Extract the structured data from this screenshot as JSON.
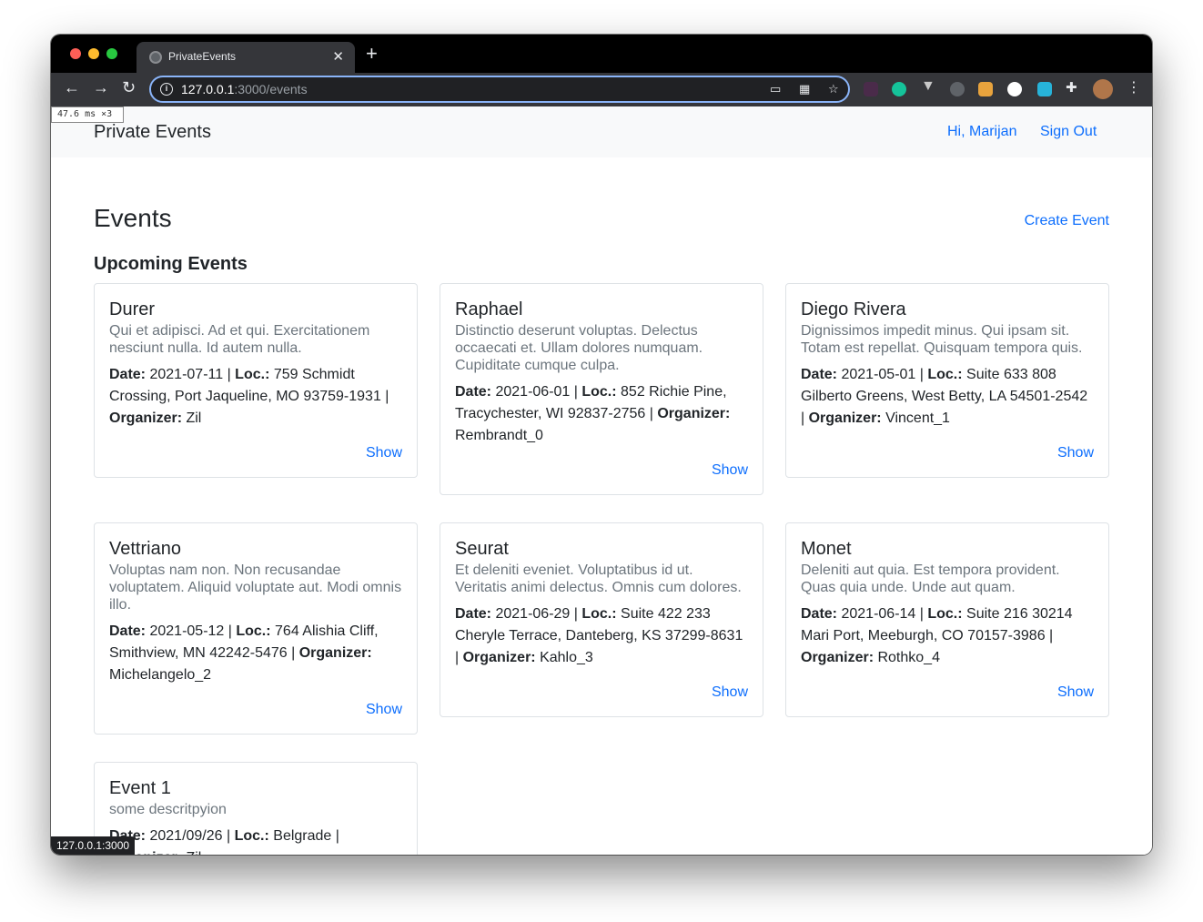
{
  "browser": {
    "tab_title": "PrivateEvents",
    "url_host": "127.0.0.1",
    "url_rest": ":3000/events",
    "status_url": "127.0.0.1:3000",
    "devtools_badge": "47.6 ms ×3"
  },
  "navbar": {
    "brand": "Private Events",
    "greeting": "Hi, Marijan",
    "sign_out": "Sign Out"
  },
  "page": {
    "title": "Events",
    "create_event": "Create Event",
    "section_title": "Upcoming Events"
  },
  "labels": {
    "date": "Date:",
    "loc": "Loc.:",
    "organizer": "Organizer:",
    "show": "Show"
  },
  "events": [
    {
      "title": "Durer",
      "description": "Qui et adipisci. Ad et qui. Exercitationem nesciunt nulla. Id autem nulla.",
      "date": "2021-07-11",
      "location": "759 Schmidt Crossing, Port Jaqueline, MO 93759-1931",
      "organizer": "Zil"
    },
    {
      "title": "Raphael",
      "description": "Distinctio deserunt voluptas. Delectus occaecati et. Ullam dolores numquam. Cupiditate cumque culpa.",
      "date": "2021-06-01",
      "location": "852 Richie Pine, Tracychester, WI 92837-2756",
      "organizer": "Rembrandt_0"
    },
    {
      "title": "Diego Rivera",
      "description": "Dignissimos impedit minus. Qui ipsam sit. Totam est repellat. Quisquam tempora quis.",
      "date": "2021-05-01",
      "location": "Suite 633 808 Gilberto Greens, West Betty, LA 54501-2542",
      "organizer": "Vincent_1"
    },
    {
      "title": "Vettriano",
      "description": "Voluptas nam non. Non recusandae voluptatem. Aliquid voluptate aut. Modi omnis illo.",
      "date": "2021-05-12",
      "location": "764 Alishia Cliff, Smithview, MN 42242-5476",
      "organizer": "Michelangelo_2"
    },
    {
      "title": "Seurat",
      "description": "Et deleniti eveniet. Voluptatibus id ut. Veritatis animi delectus. Omnis cum dolores.",
      "date": "2021-06-29",
      "location": "Suite 422 233 Cheryle Terrace, Danteberg, KS 37299-8631",
      "organizer": "Kahlo_3"
    },
    {
      "title": "Monet",
      "description": "Deleniti aut quia. Est tempora provident. Quas quia unde. Unde aut quam.",
      "date": "2021-06-14",
      "location": "Suite 216 30214 Mari Port, Meeburgh, CO 70157-3986",
      "organizer": "Rothko_4"
    },
    {
      "title": "Event 1",
      "description": "some descritpyion",
      "date": "2021/09/26",
      "location": "Belgrade",
      "organizer": "Zil"
    }
  ]
}
